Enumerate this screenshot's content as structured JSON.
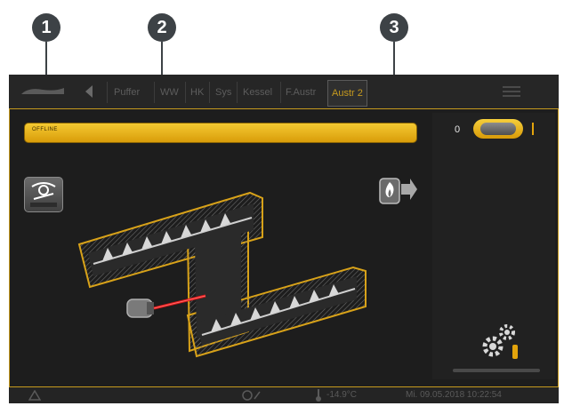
{
  "callouts": [
    "1",
    "2",
    "3"
  ],
  "tabs": [
    "Puffer",
    "WW",
    "HK",
    "Sys",
    "Kessel",
    "F.Austr",
    "Austr 2"
  ],
  "status_text": "OFFLINE",
  "toggle_label": "0",
  "bottom": {
    "temperature": "-14.9°C",
    "datetime": "Mi. 09.05.2018 10:22:54"
  },
  "colors": {
    "accent": "#c69a1e",
    "status_yellow": "#f2c42d",
    "screen_bg": "#161616",
    "callout": "#3d4246",
    "laser": "#e01818"
  },
  "icons": [
    "logo-icon",
    "back-arrow-icon",
    "eye-settings-icon",
    "fire-arrow-icon",
    "gears-icon",
    "warning-icon",
    "lock-icon",
    "thermometer-icon"
  ]
}
